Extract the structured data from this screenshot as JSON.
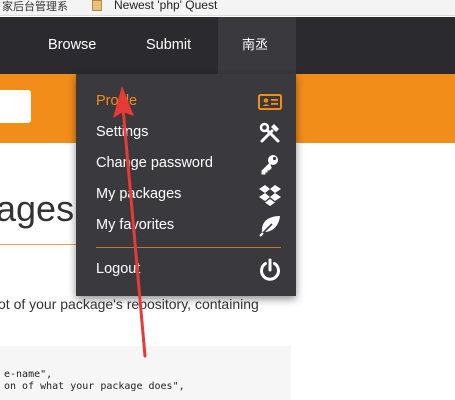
{
  "bookmarks": {
    "fragment": "家后台管理系",
    "item": "Newest 'php' Quest"
  },
  "nav": {
    "browse": "Browse",
    "submit": "Submit",
    "user": "南丞"
  },
  "dropdown": {
    "items": [
      {
        "label": "Profile",
        "icon": "id-card-icon",
        "active": true
      },
      {
        "label": "Settings",
        "icon": "tools-icon",
        "active": false
      },
      {
        "label": "Change password",
        "icon": "key-icon",
        "active": false
      },
      {
        "label": "My packages",
        "icon": "dropbox-icon",
        "active": false
      },
      {
        "label": "My favorites",
        "icon": "leaf-icon",
        "active": false
      }
    ],
    "logout": {
      "label": "Logout",
      "icon": "power-icon"
    }
  },
  "page": {
    "title_fragment": "ages",
    "paragraph_fragment": "ot of your package's repository, containing",
    "code_lines": [
      "e-name\",",
      "on of what your package does\","
    ]
  },
  "colors": {
    "navbar": "#2b2b2f",
    "dropdown": "#3a3a3e",
    "accent": "#f28d1a",
    "arrow": "#e83a36"
  }
}
